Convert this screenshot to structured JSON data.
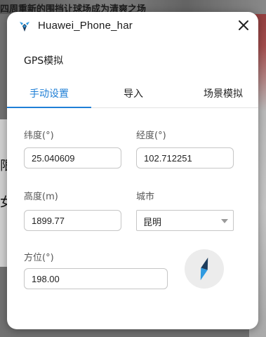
{
  "background": {
    "headline": "四周重新的围挡让球场成为清爽之场",
    "left_chars": [
      "限",
      "女"
    ]
  },
  "dialog": {
    "title": "Huawei_Phone_har",
    "section_title": "GPS模拟",
    "tabs": [
      {
        "label": "手动设置",
        "active": true
      },
      {
        "label": "导入",
        "active": false
      },
      {
        "label": "场景模拟",
        "active": false
      }
    ],
    "fields": {
      "latitude": {
        "label": "纬度(°)",
        "value": "25.040609"
      },
      "longitude": {
        "label": "经度(°)",
        "value": "102.712251"
      },
      "altitude": {
        "label": "高度(m)",
        "value": "1899.77"
      },
      "city": {
        "label": "城市",
        "value": "昆明"
      },
      "bearing": {
        "label": "方位(°)",
        "value": "198.00"
      }
    }
  },
  "colors": {
    "accent": "#1f7fd6",
    "icon_blue": "#2f9ae0",
    "icon_dark": "#1d3c5c"
  },
  "icons": {
    "app": "huawei-app-icon",
    "close": "close-icon",
    "compass": "compass-icon",
    "dropdown": "chevron-down-icon"
  }
}
